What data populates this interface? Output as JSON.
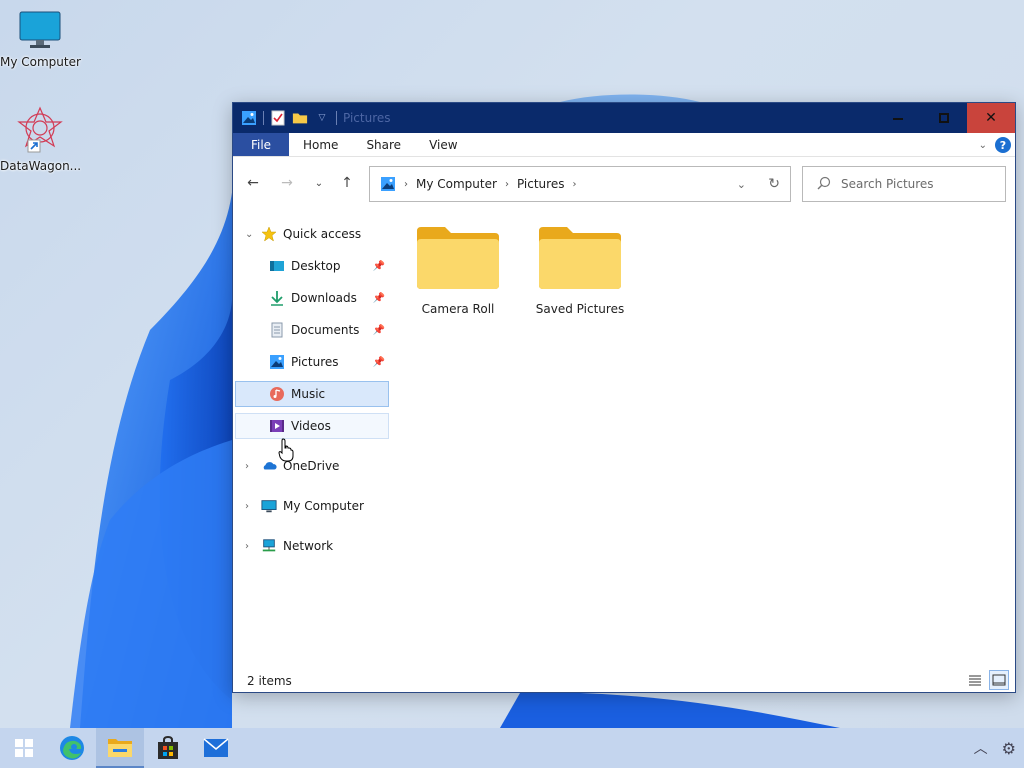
{
  "desktop": {
    "icons": [
      {
        "label": "My Computer"
      },
      {
        "label": "DataWagon..."
      }
    ]
  },
  "window": {
    "title": "Pictures",
    "ribbon_tabs": [
      "File",
      "Home",
      "Share",
      "View"
    ],
    "help_label": "?",
    "address": {
      "crumbs": [
        "My Computer",
        "Pictures"
      ]
    },
    "search_placeholder": "Search Pictures",
    "nav": {
      "quick_access": "Quick access",
      "quick_items": [
        "Desktop",
        "Downloads",
        "Documents",
        "Pictures",
        "Music",
        "Videos"
      ],
      "onedrive": "OneDrive",
      "my_computer": "My Computer",
      "network": "Network"
    },
    "folders": [
      "Camera Roll",
      "Saved Pictures"
    ],
    "status": "2 items"
  },
  "colors": {
    "titlebar": "#0a2a6b",
    "file_tab": "#2b4fa1",
    "close": "#c9443c",
    "selection": "#d9e8fb",
    "folder": "#f7c948"
  }
}
